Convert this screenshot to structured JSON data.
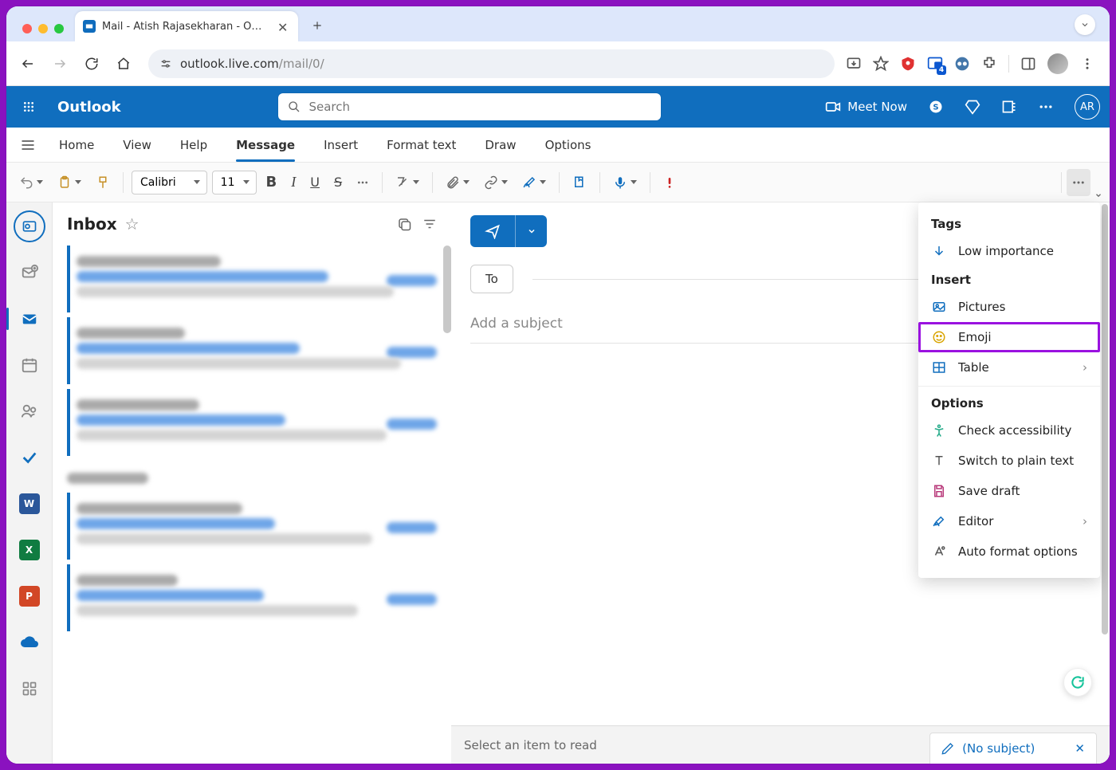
{
  "browser": {
    "tab_title": "Mail - Atish Rajasekharan - O…",
    "url_host": "outlook.live.com",
    "url_path": "/mail/0/",
    "badge": "4"
  },
  "suite": {
    "brand": "Outlook",
    "search_placeholder": "Search",
    "meet_now": "Meet Now",
    "initials": "AR"
  },
  "ribbon_tabs": {
    "home": "Home",
    "view": "View",
    "help": "Help",
    "message": "Message",
    "insert": "Insert",
    "format": "Format text",
    "draw": "Draw",
    "options": "Options"
  },
  "toolbar": {
    "font_name": "Calibri",
    "font_size": "11"
  },
  "maillist": {
    "title": "Inbox"
  },
  "compose": {
    "to_label": "To",
    "subject_placeholder": "Add a subject"
  },
  "statusbar": {
    "select_label": "Select an item to read",
    "compose_tab": "(No subject)"
  },
  "menu": {
    "tags_h": "Tags",
    "low_importance": "Low importance",
    "insert_h": "Insert",
    "pictures": "Pictures",
    "emoji": "Emoji",
    "table": "Table",
    "options_h": "Options",
    "accessibility": "Check accessibility",
    "plain_text": "Switch to plain text",
    "save_draft": "Save draft",
    "editor": "Editor",
    "auto_format": "Auto format options"
  }
}
